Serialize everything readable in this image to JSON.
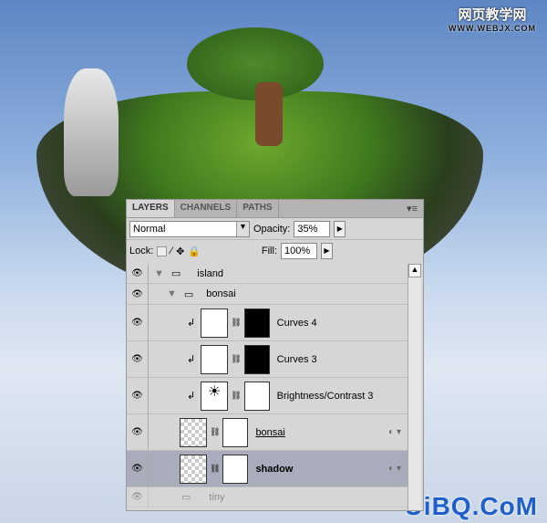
{
  "watermark_top": {
    "line1": "网页教学网",
    "line2": "WWW.WEBJX.COM"
  },
  "watermark_bottom": "UiBQ.CoM",
  "panel": {
    "tabs": [
      {
        "label": "LAYERS",
        "active": true
      },
      {
        "label": "CHANNELS"
      },
      {
        "label": "PATHS"
      }
    ],
    "menu_icon": "panel-menu-icon",
    "blend_mode": "Normal",
    "opacity_label": "Opacity:",
    "opacity": "35%",
    "lock_label": "Lock:",
    "fill_label": "Fill:",
    "fill": "100%",
    "layers": [
      {
        "name": "island",
        "type": "group",
        "expanded": true
      },
      {
        "name": "bonsai",
        "type": "group",
        "expanded": true
      },
      {
        "name": "Curves 4",
        "type": "adjustment",
        "icon": "curves-icon",
        "mask": "black"
      },
      {
        "name": "Curves 3",
        "type": "adjustment",
        "icon": "curves-icon",
        "mask": "black"
      },
      {
        "name": "Brightness/Contrast 3",
        "type": "adjustment",
        "icon": "brightness-icon",
        "mask": "white"
      },
      {
        "name": "bonsai",
        "type": "smart-object",
        "mask": "white"
      },
      {
        "name": "shadow",
        "type": "smart-object",
        "mask": "white",
        "selected": true
      },
      {
        "name": "tiny",
        "type": "group"
      }
    ]
  }
}
